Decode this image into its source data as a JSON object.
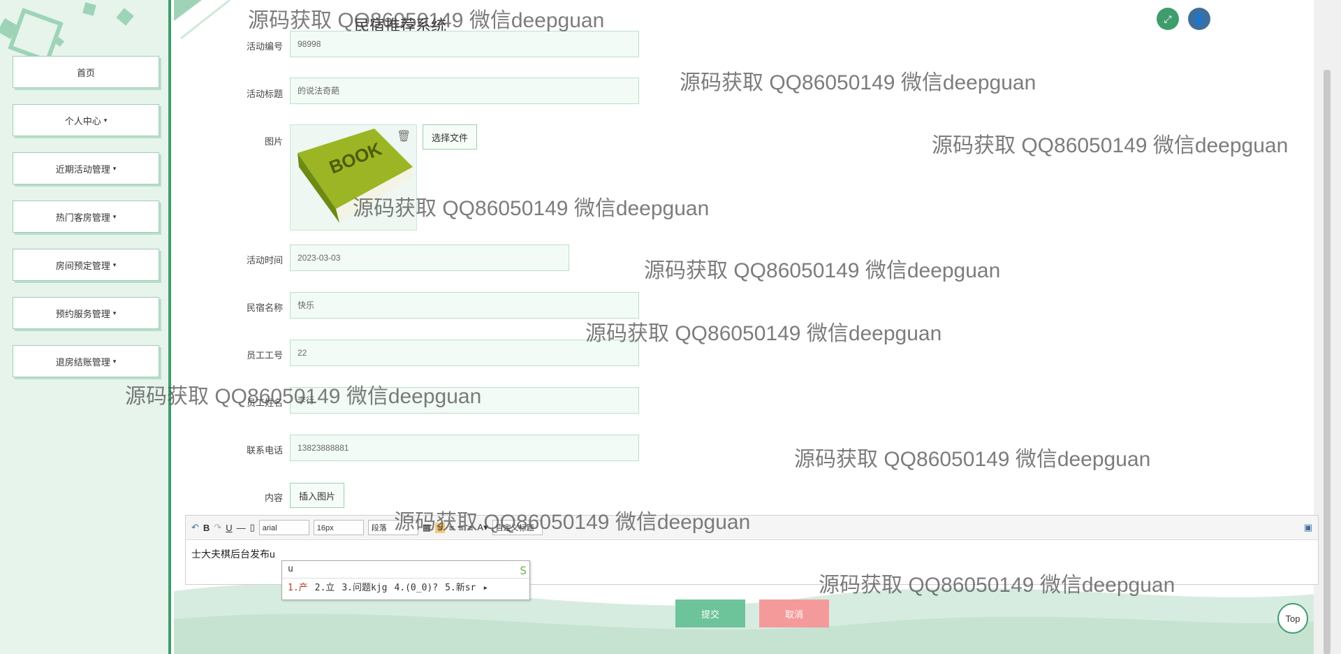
{
  "header": {
    "title": "民宿推荐系统"
  },
  "sidebar": {
    "items": [
      {
        "label": "首页",
        "caret": ""
      },
      {
        "label": "个人中心",
        "caret": "▾"
      },
      {
        "label": "近期活动管理",
        "caret": "▾"
      },
      {
        "label": "热门客房管理",
        "caret": "▾"
      },
      {
        "label": "房间预定管理",
        "caret": "▾"
      },
      {
        "label": "预约服务管理",
        "caret": "▾"
      },
      {
        "label": "退房结账管理",
        "caret": "▾"
      }
    ]
  },
  "form": {
    "activity_no": {
      "label": "活动编号",
      "value": "98998"
    },
    "activity_title": {
      "label": "活动标题",
      "value": "的说法奇葩"
    },
    "image": {
      "label": "图片",
      "choose_file": "选择文件",
      "book_text": "BOOK"
    },
    "activity_time": {
      "label": "活动时间",
      "value": "2023-03-03"
    },
    "homestay_name": {
      "label": "民宿名称",
      "value": "快乐"
    },
    "staff_no": {
      "label": "员工工号",
      "value": "22"
    },
    "staff_name": {
      "label": "员工姓名",
      "value": "李行"
    },
    "phone": {
      "label": "联系电话",
      "value": "13823888881"
    },
    "content": {
      "label": "内容",
      "insert_image": "插入图片"
    }
  },
  "editor": {
    "font": "arial",
    "size": "16px",
    "paragraph": "段落",
    "custom_title": "自定义标题",
    "text": "士大夫棋后台发布u"
  },
  "ime": {
    "input": "u",
    "candidates": [
      "1.产",
      "2.立",
      "3.问题kjg",
      "4.(0_0)?",
      "5.新sr"
    ]
  },
  "actions": {
    "submit": "提交",
    "cancel": "取消"
  },
  "top_button": "Top",
  "watermark": "源码获取 QQ86050149 微信deepguan",
  "colors": {
    "accent": "#3f9c6c",
    "submit": "#6dc39a",
    "cancel": "#f59a9a"
  }
}
